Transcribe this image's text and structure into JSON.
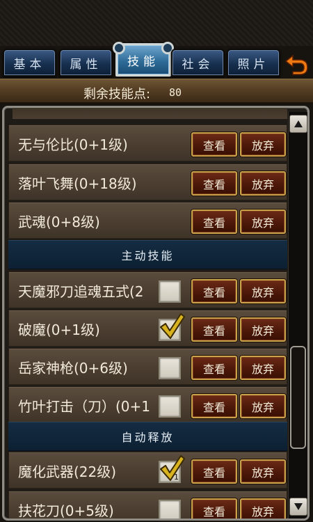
{
  "tabs": [
    {
      "label": "基本"
    },
    {
      "label": "属性"
    },
    {
      "label": "技能"
    },
    {
      "label": "社会"
    },
    {
      "label": "照片"
    }
  ],
  "active_tab": "技能",
  "skill_points": {
    "label": "剩余技能点:",
    "value": "80"
  },
  "buttons": {
    "view": "查看",
    "drop": "放弃"
  },
  "passive_skills": [
    {
      "name": "无与伦比(0+1级)"
    },
    {
      "name": "落叶飞舞(0+18级)"
    },
    {
      "name": "武魂(0+8级)"
    }
  ],
  "sections": {
    "active": "主动技能",
    "auto": "自动释放"
  },
  "active_skills": [
    {
      "name": "天魔邪刀追魂五式(2",
      "checked": false
    },
    {
      "name": "破魔(0+1级)",
      "checked": true
    },
    {
      "name": "岳家神枪(0+6级)",
      "checked": false
    },
    {
      "name": "竹叶打击（刀）(0+1",
      "checked": false
    }
  ],
  "auto_skills": [
    {
      "name": "魔化武器(22级)",
      "checked": true,
      "count": "1"
    },
    {
      "name": "扶花刀(0+5级)",
      "checked": false
    }
  ],
  "colors": {
    "button_border": "#caa24a",
    "section_bg": "#0d2033",
    "row_bg": "#4a3d30"
  }
}
